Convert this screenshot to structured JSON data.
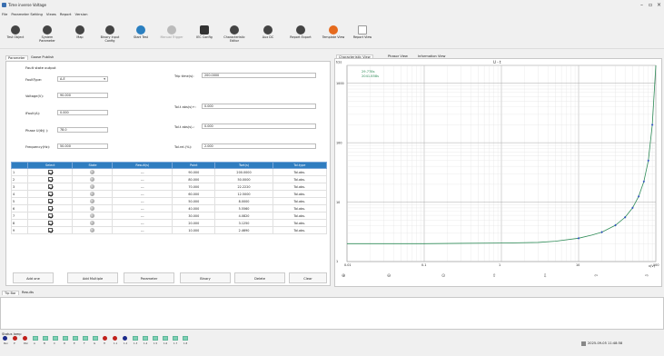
{
  "window": {
    "title": "Time inverse Voltage"
  },
  "menu": [
    "File",
    "Parameter Setting",
    "Views",
    "Report",
    "Version"
  ],
  "toolbar": [
    {
      "label": "Test Object",
      "icon": "test-object-icon"
    },
    {
      "label": "System Parameter",
      "icon": "system-parameter-icon"
    },
    {
      "label": "Map",
      "icon": "map-icon"
    },
    {
      "label": "Binary input Config",
      "icon": "binary-input-config-icon"
    },
    {
      "label": "Start Test",
      "icon": "play-icon"
    },
    {
      "label": "Manual Trigger",
      "icon": "manual-trigger-icon"
    },
    {
      "label": "IEC Config",
      "icon": "gear-icon"
    },
    {
      "label": "Characteristic Editor",
      "icon": "characteristic-editor-icon"
    },
    {
      "label": "Aux DC",
      "icon": "aux-dc-icon"
    },
    {
      "label": "Report Export",
      "icon": "report-export-icon"
    },
    {
      "label": "Template View",
      "icon": "template-view-icon"
    },
    {
      "label": "Report View",
      "icon": "report-view-icon"
    }
  ],
  "left_tabs": [
    "Parameter",
    "Goose Publish"
  ],
  "fault_state_output": {
    "title": "Fault state output",
    "fault_type_label": "FaultType:",
    "fault_type_value": "A-E",
    "voltage_label": "Voltage(V):",
    "voltage_value": "90.000",
    "ifault_label": "IFault(A):",
    "ifault_value": "0.000",
    "phase_label": "Phase U(Φ)( ):",
    "phase_value": "78.0",
    "frequency_label": "Frequency(Hz):",
    "frequency_value": "50.000"
  },
  "trip_settings": {
    "trip_time_label": "Trip time(s):",
    "trip_time_value": "200.0000",
    "tol_rel_label": "Tol.t abs(s)+:",
    "tol_rel_value": "0.000",
    "tol_abs_label": "Tol.t abs(s)-:",
    "tol_abs_value": "0.000",
    "tol_rel_pct_label": "Tol.rel.(%):",
    "tol_rel_pct_value": "2.000"
  },
  "table": {
    "columns": [
      "Select",
      "State",
      "Result(s)",
      "Point",
      "Tset(s)",
      "Tol.type"
    ],
    "rows": [
      {
        "idx": "1",
        "result": "---",
        "point": "90.000",
        "tset": "200.0000",
        "tol": "Tol.abs."
      },
      {
        "idx": "2",
        "result": "---",
        "point": "80.000",
        "tset": "50.0000",
        "tol": "Tol.abs."
      },
      {
        "idx": "3",
        "result": "---",
        "point": "70.000",
        "tset": "22.2220",
        "tol": "Tol.abs."
      },
      {
        "idx": "4",
        "result": "---",
        "point": "60.000",
        "tset": "12.5000",
        "tol": "Tol.abs."
      },
      {
        "idx": "5",
        "result": "---",
        "point": "50.000",
        "tset": "8.0000",
        "tol": "Tol.abs."
      },
      {
        "idx": "6",
        "result": "---",
        "point": "40.000",
        "tset": "5.5560",
        "tol": "Tol.abs."
      },
      {
        "idx": "7",
        "result": "---",
        "point": "30.000",
        "tset": "4.0820",
        "tol": "Tol.abs."
      },
      {
        "idx": "8",
        "result": "---",
        "point": "20.000",
        "tset": "3.1250",
        "tol": "Tol.abs."
      },
      {
        "idx": "9",
        "result": "---",
        "point": "10.000",
        "tset": "2.4690",
        "tol": "Tol.abs."
      }
    ]
  },
  "buttons": [
    "Add one",
    "Add Multiple",
    "Parameter",
    "Binary",
    "Delete",
    "Clear"
  ],
  "right_tabs": [
    "Characteristic View",
    "Phasor View",
    "Information View"
  ],
  "chart": {
    "ylabel": "t(s)",
    "title": "U - t",
    "readout": [
      "29.778s",
      "2041.858s"
    ],
    "y_ticks": [
      "1000",
      "100",
      "10",
      "1"
    ],
    "x_ticks": [
      "0.01",
      "0.1",
      "1",
      "10",
      "100"
    ],
    "x_unit": "x(V)",
    "toolbar": [
      "zoom-in-icon",
      "zoom-out-icon",
      "zoom-fit-icon",
      "pan-up-icon",
      "pan-down-icon",
      "pan-left-icon",
      "pan-right-icon"
    ]
  },
  "chart_data": {
    "type": "line",
    "title": "U - t",
    "xlabel": "x(V)",
    "ylabel": "t(s)",
    "xlog": true,
    "ylog": true,
    "xlim": [
      0.01,
      100
    ],
    "ylim": [
      1,
      2000
    ],
    "series": [
      {
        "x": [
          0.01,
          0.1,
          1,
          3,
          5,
          10,
          15,
          20,
          30,
          40,
          50,
          60,
          70,
          80,
          90,
          100
        ],
        "y": [
          2.0,
          2.0,
          2.05,
          2.1,
          2.2,
          2.469,
          2.8,
          3.125,
          4.082,
          5.556,
          8.0,
          12.5,
          22.222,
          50.0,
          200.0,
          2000.0
        ]
      }
    ],
    "points": {
      "x": [
        10,
        20,
        30,
        40,
        50,
        60,
        70,
        80,
        90
      ],
      "y": [
        2.469,
        3.125,
        4.082,
        5.556,
        8.0,
        12.5,
        22.222,
        50.0,
        200.0
      ]
    },
    "line_color": "#2e8b57",
    "point_color": "#3050c0"
  },
  "bottom_tabs": [
    "Tip Bar",
    "Results"
  ],
  "status": {
    "title": "Status lamp",
    "labels": [
      "Run",
      "P",
      "Dbc",
      "A",
      "B",
      "C",
      "D",
      "E",
      "F",
      "G",
      "H",
      "1.1",
      "1.2",
      "1.3",
      "1.4",
      "1.5",
      "1.6",
      "1.7",
      "1.8"
    ],
    "datetime": "2025-09-05 11:48:58"
  }
}
